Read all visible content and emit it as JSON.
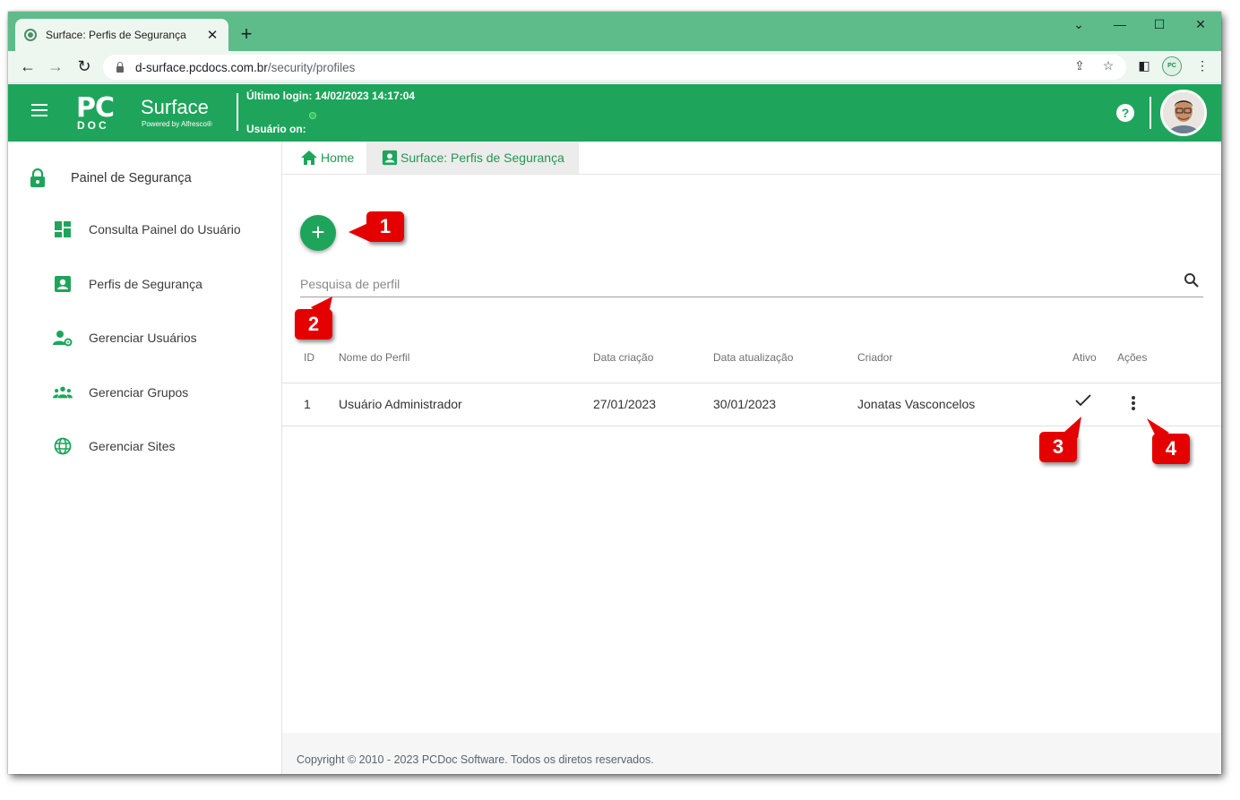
{
  "browser": {
    "tab_title": "Surface: Perfis de Segurança",
    "url_host": "d-surface.pcdocs.com.br",
    "url_path": "/security/profiles",
    "profile_badge": "PC"
  },
  "header": {
    "logo_pc": "PC",
    "logo_doc": "DOC",
    "logo_surface": "Surface",
    "logo_powered": "Powered by Alfresco®",
    "last_login": "Último login: 14/02/2023 14:17:04",
    "user_on": "Usuário on:",
    "help": "?"
  },
  "sidebar": {
    "title": "Painel de Segurança",
    "items": [
      {
        "label": "Consulta Painel do Usuário",
        "icon": "dashboard-icon"
      },
      {
        "label": "Perfis de Segurança",
        "icon": "profile-icon"
      },
      {
        "label": "Gerenciar Usuários",
        "icon": "manage-users-icon"
      },
      {
        "label": "Gerenciar Grupos",
        "icon": "groups-icon"
      },
      {
        "label": "Gerenciar Sites",
        "icon": "globe-icon"
      }
    ]
  },
  "breadcrumbs": {
    "home": "Home",
    "current": "Surface: Perfis de Segurança"
  },
  "search": {
    "placeholder": "Pesquisa de perfil"
  },
  "table": {
    "headers": [
      "ID",
      "Nome do Perfil",
      "Data criação",
      "Data atualização",
      "Criador",
      "Ativo",
      "Ações"
    ],
    "rows": [
      {
        "id": "1",
        "name": "Usuário Administrador",
        "created": "27/01/2023",
        "updated": "30/01/2023",
        "creator": "Jonatas Vasconcelos",
        "active": true
      }
    ]
  },
  "callouts": [
    "1",
    "2",
    "3",
    "4"
  ],
  "footer": {
    "copyright": "Copyright © 2010 - 2023 PCDoc Software. Todos os diretos reservados."
  },
  "colors": {
    "brand_green": "#1ea55b",
    "tabstrip_green": "#5dbc8a",
    "callout_red": "#e50000"
  }
}
